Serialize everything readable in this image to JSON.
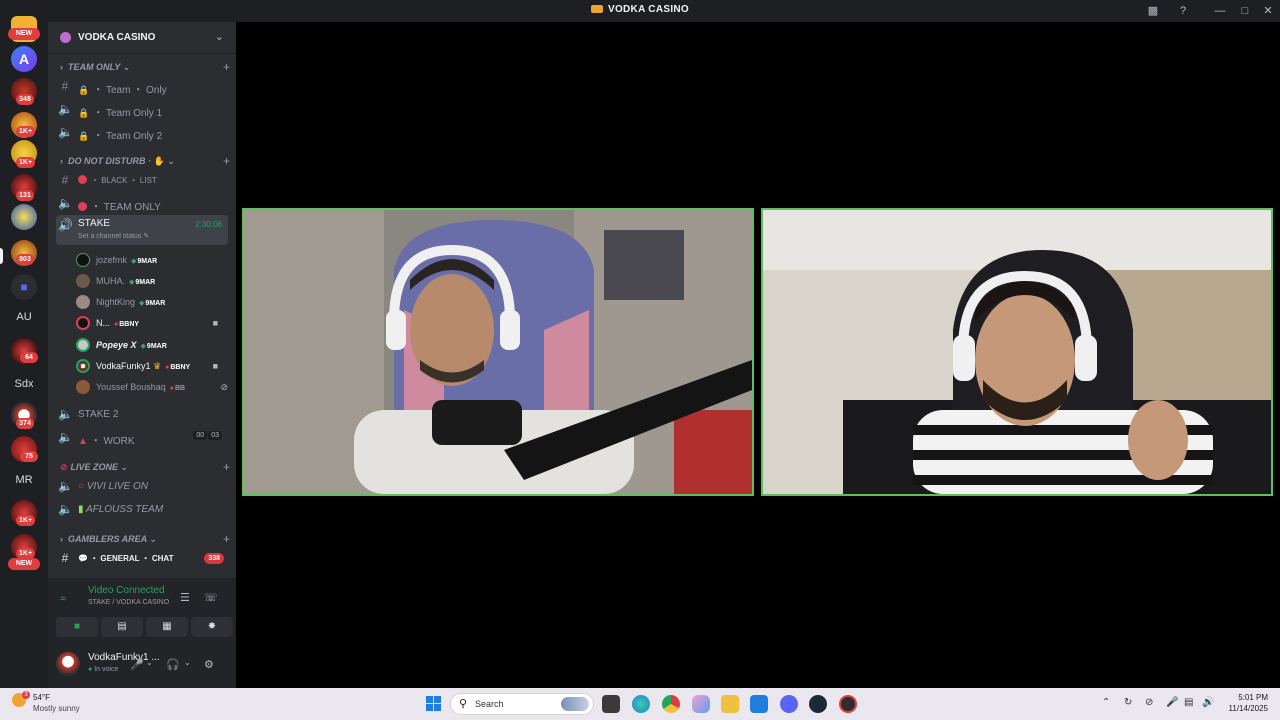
{
  "window": {
    "title": "VODKA CASINO"
  },
  "rail": {
    "new_top": "NEW",
    "new_bottom": "NEW",
    "badges": [
      "348",
      "1K+",
      "1K+",
      "131",
      "803",
      "64",
      "374",
      "75",
      "1K+",
      "1K+"
    ],
    "text_servers": [
      "AU",
      "Sdx",
      "MR"
    ]
  },
  "guild": {
    "name": "VODKA CASINO"
  },
  "categories": {
    "team_only": "TEAM ONLY",
    "do_not_disturb": "DO NOT DISTURB ·",
    "live_zone": "LIVE ZONE",
    "gamblers_area": "GAMBLERS AREA"
  },
  "channels": {
    "team_only_text": "・ Team ・ Only",
    "team_only_1": "・ Team Only 1",
    "team_only_2": "・ Team Only 2",
    "black_list": "・ BLACK ・ LIST",
    "team_only_voice": "・ TEAM ONLY",
    "stake": "STAKE",
    "stake_status": "Set a channel status",
    "stake_timer": "2:30:06",
    "stake2": "STAKE 2",
    "work": "・ WORK",
    "work_count_a": "00",
    "work_count_b": "03",
    "vivi": "VIVI LIVE ON",
    "aflouss": "AFLOUSS TEAM",
    "general": "・ GENERAL ・ CHAT",
    "general_badge": "338"
  },
  "voice_users": [
    {
      "name": "jozefmk",
      "tag": "9MAR"
    },
    {
      "name": "MUHA.",
      "tag": "9MAR"
    },
    {
      "name": "NightKing",
      "tag": "9MAR"
    },
    {
      "name": "N...",
      "tag": "BBNY"
    },
    {
      "name": "Popeye X",
      "tag": "9MAR"
    },
    {
      "name": "VodkaFunky1",
      "tag": "BBNY"
    },
    {
      "name": "Youssef Boushaq",
      "tag": "BB"
    }
  ],
  "voice_panel": {
    "status": "Video Connected",
    "location": "STAKE / VODKA CASINO"
  },
  "user_panel": {
    "name": "VodkaFunky1 ...",
    "status": "In voice"
  },
  "taskbar": {
    "weather_alert": "3",
    "temperature": "54°F",
    "condition": "Mostly sunny",
    "search_placeholder": "Search",
    "time": "5:01 PM",
    "date": "11/14/2025"
  },
  "colors": {
    "accent_green": "#23a55a",
    "tile_border": "#5fbf5f",
    "badge_red": "#e03e3e"
  }
}
